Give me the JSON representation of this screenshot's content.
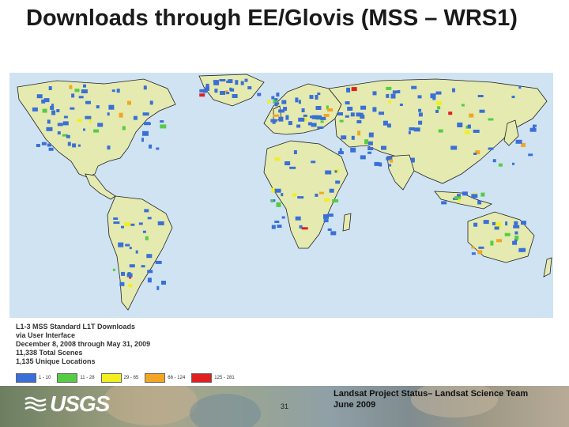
{
  "slide": {
    "title": "Downloads through EE/Glovis (MSS – WRS1)"
  },
  "legend": {
    "lines": [
      "L1-3 MSS Standard L1T Downloads",
      "via User Interface",
      "December 8, 2008 through May 31, 2009",
      "11,338 Total Scenes",
      "1,135 Unique Locations"
    ],
    "classes": [
      {
        "label": "1 - 10",
        "color": "#3a6fd8"
      },
      {
        "label": "11 - 28",
        "color": "#55cc44"
      },
      {
        "label": "29 - 65",
        "color": "#f2ee22"
      },
      {
        "label": "66 - 124",
        "color": "#f2a623"
      },
      {
        "label": "125 - 281",
        "color": "#e02020"
      }
    ]
  },
  "map": {
    "ocean_color": "#cfe3f3",
    "land_color": "#e4eab0",
    "border_color": "#222222"
  },
  "footer": {
    "logo": "USGS",
    "slide_number": "31",
    "line1": "Landsat Project Status– Landsat Science Team",
    "line2": "June 2009"
  }
}
